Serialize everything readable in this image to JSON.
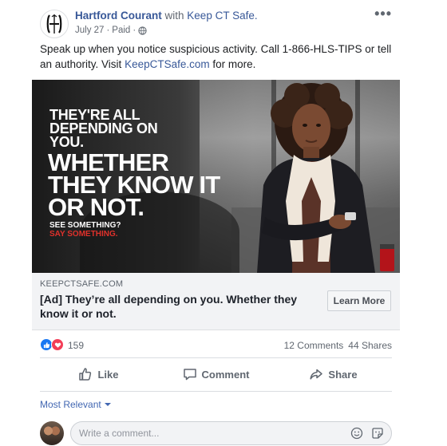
{
  "post": {
    "page_name": "Hartford Courant",
    "with_text": "with",
    "partner_name": "Keep CT Safe.",
    "date": "July 27",
    "separator": "·",
    "paid": "Paid",
    "separator2": "·",
    "more_label": "•••",
    "text_prefix": "Speak up when you notice suspicious activity. Call 1-866-HLS-TIPS or tell an authority. Visit ",
    "text_link": "KeepCTSafe.com",
    "text_suffix": " for more."
  },
  "ad_image": {
    "line1": "They're all depending on you.",
    "line2": "Whether they know it or not.",
    "line3": "See something?",
    "line4": "Say something."
  },
  "link_preview": {
    "domain": "KEEPCTSAFE.COM",
    "title": "[Ad] They’re all depending on you. Whether they know it or not.",
    "cta": "Learn More"
  },
  "reactions": {
    "count": "159",
    "comments": "12 Comments",
    "shares": "44 Shares"
  },
  "actions": {
    "like": "Like",
    "comment": "Comment",
    "share": "Share"
  },
  "comments": {
    "sort": "Most Relevant",
    "placeholder": "Write a comment..."
  },
  "icons": [
    "hartford-courant-logo",
    "globe-icon",
    "like-icon",
    "love-icon",
    "thumbs-up-icon",
    "comment-icon",
    "share-icon",
    "emoji-icon",
    "sticker-icon",
    "chevron-down-icon"
  ],
  "colors": {
    "link_blue": "#385898",
    "accent_blue": "#4267b2",
    "like_blue": "#1877f2",
    "love_red": "#f33e58",
    "ad_red": "#e0312b"
  }
}
